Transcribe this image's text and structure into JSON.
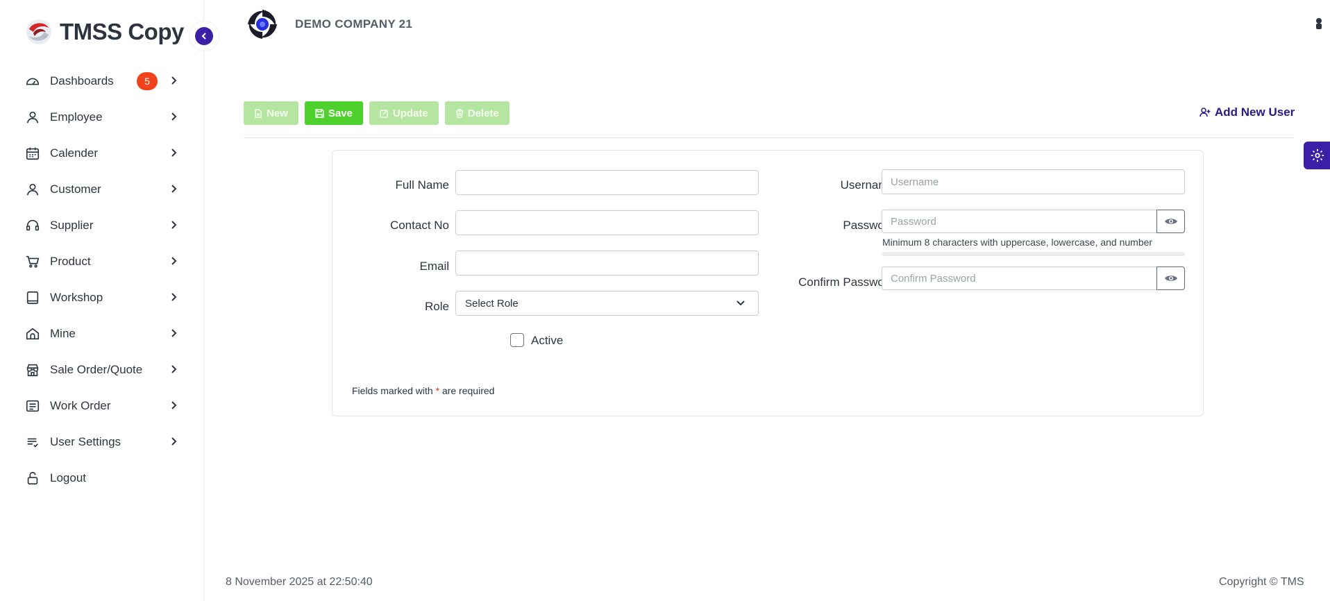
{
  "brand": {
    "name": "TMSS Copy"
  },
  "sidebar": {
    "items": [
      {
        "label": "Dashboards",
        "icon": "gauge-icon",
        "badge": "5"
      },
      {
        "label": "Employee",
        "icon": "person-icon"
      },
      {
        "label": "Calender",
        "icon": "calendar-icon"
      },
      {
        "label": "Customer",
        "icon": "person-icon"
      },
      {
        "label": "Supplier",
        "icon": "headset-icon"
      },
      {
        "label": "Product",
        "icon": "cart-icon"
      },
      {
        "label": "Workshop",
        "icon": "book-icon"
      },
      {
        "label": "Mine",
        "icon": "home-icon"
      },
      {
        "label": "Sale Order/Quote",
        "icon": "store-icon"
      },
      {
        "label": "Work Order",
        "icon": "document-icon"
      },
      {
        "label": "User Settings",
        "icon": "list-check-icon"
      },
      {
        "label": "Logout",
        "icon": "unlock-icon"
      }
    ]
  },
  "header": {
    "company": "DEMO COMPANY 21"
  },
  "toolbar": {
    "new_label": "New",
    "save_label": "Save",
    "update_label": "Update",
    "delete_label": "Delete",
    "add_user_label": "Add New User"
  },
  "form": {
    "full_name": {
      "label": "Full Name",
      "value": ""
    },
    "contact_no": {
      "label": "Contact No",
      "value": ""
    },
    "email": {
      "label": "Email",
      "value": ""
    },
    "role": {
      "label": "Role",
      "selected": "Select Role"
    },
    "active": {
      "label": "Active",
      "checked": false
    },
    "username": {
      "label": "Username",
      "placeholder": "Username"
    },
    "password": {
      "label": "Password",
      "placeholder": "Password",
      "hint": "Minimum 8 characters with uppercase, lowercase, and number"
    },
    "confirm_password": {
      "label": "Confirm Password",
      "placeholder": "Confirm Password"
    },
    "required_note_prefix": "Fields marked with",
    "required_star": "*",
    "required_note_suffix": "are required"
  },
  "footer": {
    "timestamp": "8 November 2025 at 22:50:40",
    "copyright": "Copyright © TMS"
  },
  "colors": {
    "accent": "#3b1fa6",
    "save_green": "#4fd12d",
    "faded_green": "#b4e5a1",
    "badge_red": "#f2421b"
  }
}
